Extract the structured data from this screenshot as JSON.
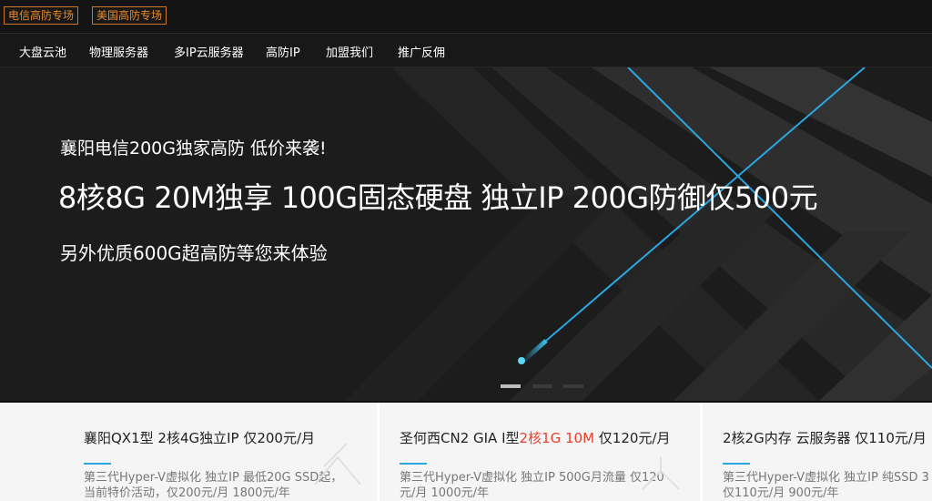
{
  "topbar": {
    "tags": [
      "电信高防专场",
      "美国高防专场"
    ]
  },
  "nav": {
    "items": [
      "大盘云池",
      "物理服务器",
      "多IP云服务器",
      "高防IP",
      "加盟我们",
      "推广反佣"
    ]
  },
  "hero": {
    "line1": "襄阳电信200G独家高防 低价来袭!",
    "line2": "8核8G 20M独享 100G固态硬盘 独立IP 200G防御仅500元",
    "line3": "另外优质600G超高防等您来体验",
    "slides": 3,
    "active_slide": 1
  },
  "cards": [
    {
      "title_pre": "襄阳QX1型 2核4G独立IP 仅200元/月",
      "title_hl": "",
      "title_post": "",
      "desc1": "第三代Hyper-V虚拟化 独立IP 最低20G SSD起，",
      "desc2": "当前特价活动，仅200元/月 1800元/年"
    },
    {
      "title_pre": "圣何西CN2 GIA I型",
      "title_hl": "2核1G 10M",
      "title_post": " 仅120元/月",
      "desc1": "第三代Hyper-V虚拟化 独立IP 500G月流量 仅120",
      "desc2": "元/月  1000元/年"
    },
    {
      "title_pre": "2核2G内存 云服务器 仅110元/月",
      "title_hl": "",
      "title_post": "",
      "desc1": "第三代Hyper-V虚拟化 独立IP 纯SSD  3",
      "desc2": "仅110元/月 900元/年"
    }
  ],
  "colors": {
    "accent_blue": "#2aa6e0",
    "tag_orange": "#e98a2a",
    "highlight_red": "#e8402a"
  }
}
